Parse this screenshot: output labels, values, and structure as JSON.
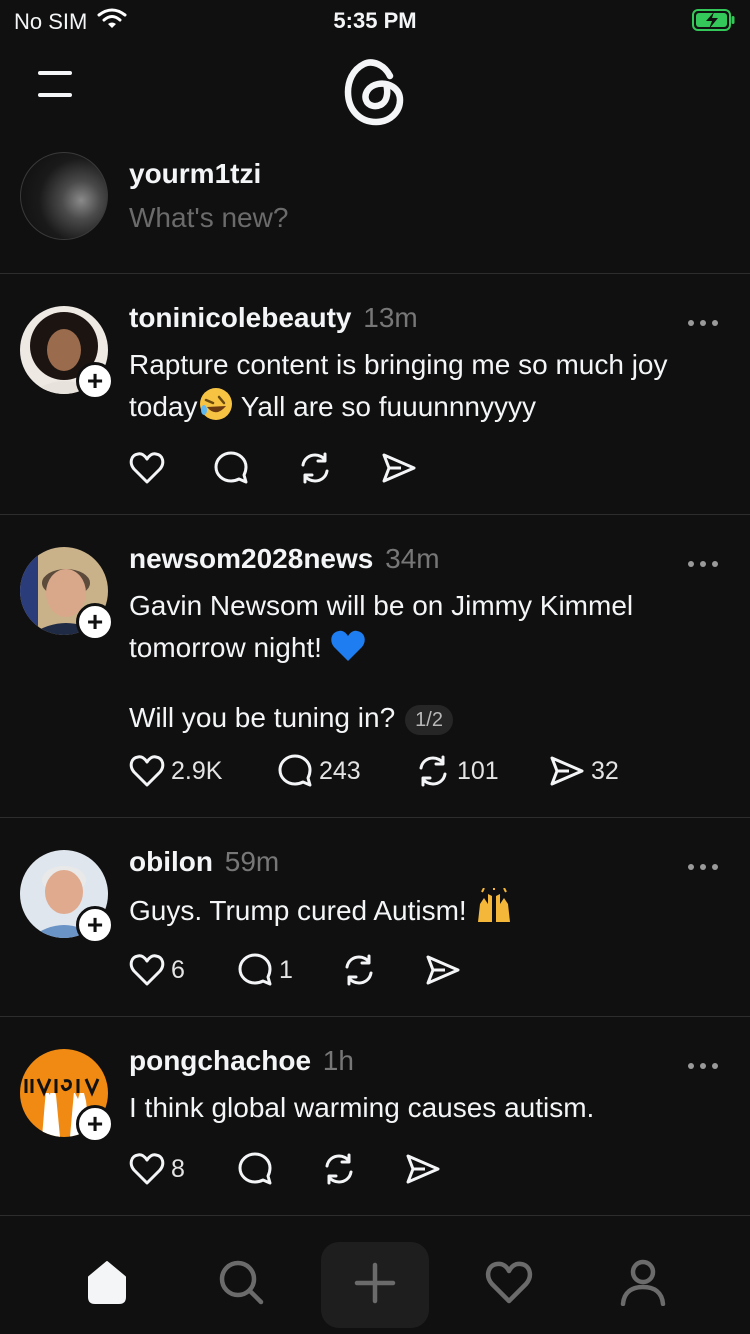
{
  "status_bar": {
    "carrier": "No SIM",
    "time": "5:35 PM"
  },
  "composer": {
    "username": "yourm1tzi",
    "placeholder": "What's new?"
  },
  "posts": [
    {
      "username": "toninicolebeauty",
      "time": "13m",
      "text_line1": "Rapture content is bringing me so much joy",
      "text_line2_a": "today",
      "text_line2_b": " Yall are so fuuunnnyyyy",
      "likes": "",
      "replies": "",
      "reposts": "",
      "shares": ""
    },
    {
      "username": "newsom2028news",
      "time": "34m",
      "text_line1": "Gavin Newsom will be on Jimmy Kimmel",
      "text_line2": "tomorrow night! ",
      "text_line3": "Will you be tuning in?",
      "page_indicator": "1/2",
      "likes": "2.9K",
      "replies": "243",
      "reposts": "101",
      "shares": "32"
    },
    {
      "username": "obilon",
      "time": "59m",
      "text": "Guys. Trump cured Autism! ",
      "likes": "6",
      "replies": "1",
      "reposts": "",
      "shares": ""
    },
    {
      "username": "pongchachoe",
      "time": "1h",
      "text": "I think global warming causes autism.",
      "likes": "8",
      "replies": "",
      "reposts": "",
      "shares": ""
    }
  ],
  "colors": {
    "background": "#101010",
    "text": "#f3f5f7",
    "muted": "#777777",
    "divider": "#2d2d2d",
    "battery": "#34c759"
  },
  "icons": [
    "menu-icon",
    "threads-logo",
    "heart-icon",
    "comment-icon",
    "repost-icon",
    "share-icon",
    "more-icon",
    "home-icon",
    "search-icon",
    "plus-icon",
    "profile-icon"
  ]
}
